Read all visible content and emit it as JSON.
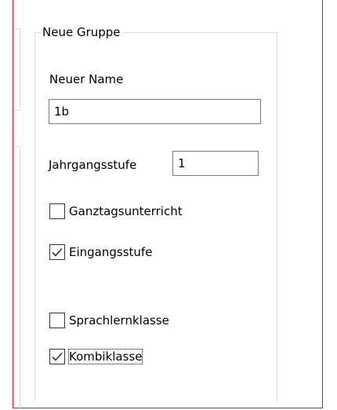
{
  "group": {
    "title": "Neue Gruppe"
  },
  "name_field": {
    "label": "Neuer Name",
    "value": "1b"
  },
  "grade_field": {
    "label": "Jahrgangsstufe",
    "value": "1"
  },
  "checkboxes": [
    {
      "label": "Ganztagsunterricht",
      "checked": false,
      "focused": false
    },
    {
      "label": "Eingangsstufe",
      "checked": true,
      "focused": false
    },
    {
      "label": "Sprachlernklasse",
      "checked": false,
      "focused": false
    },
    {
      "label": "Kombiklasse",
      "checked": true,
      "focused": true
    }
  ],
  "colors": {
    "window_border": "#e81123",
    "groupbox_border": "#dcdcdc",
    "textbox_border": "#7a7a7a"
  },
  "icons": {
    "checkmark": "checkmark-icon"
  }
}
